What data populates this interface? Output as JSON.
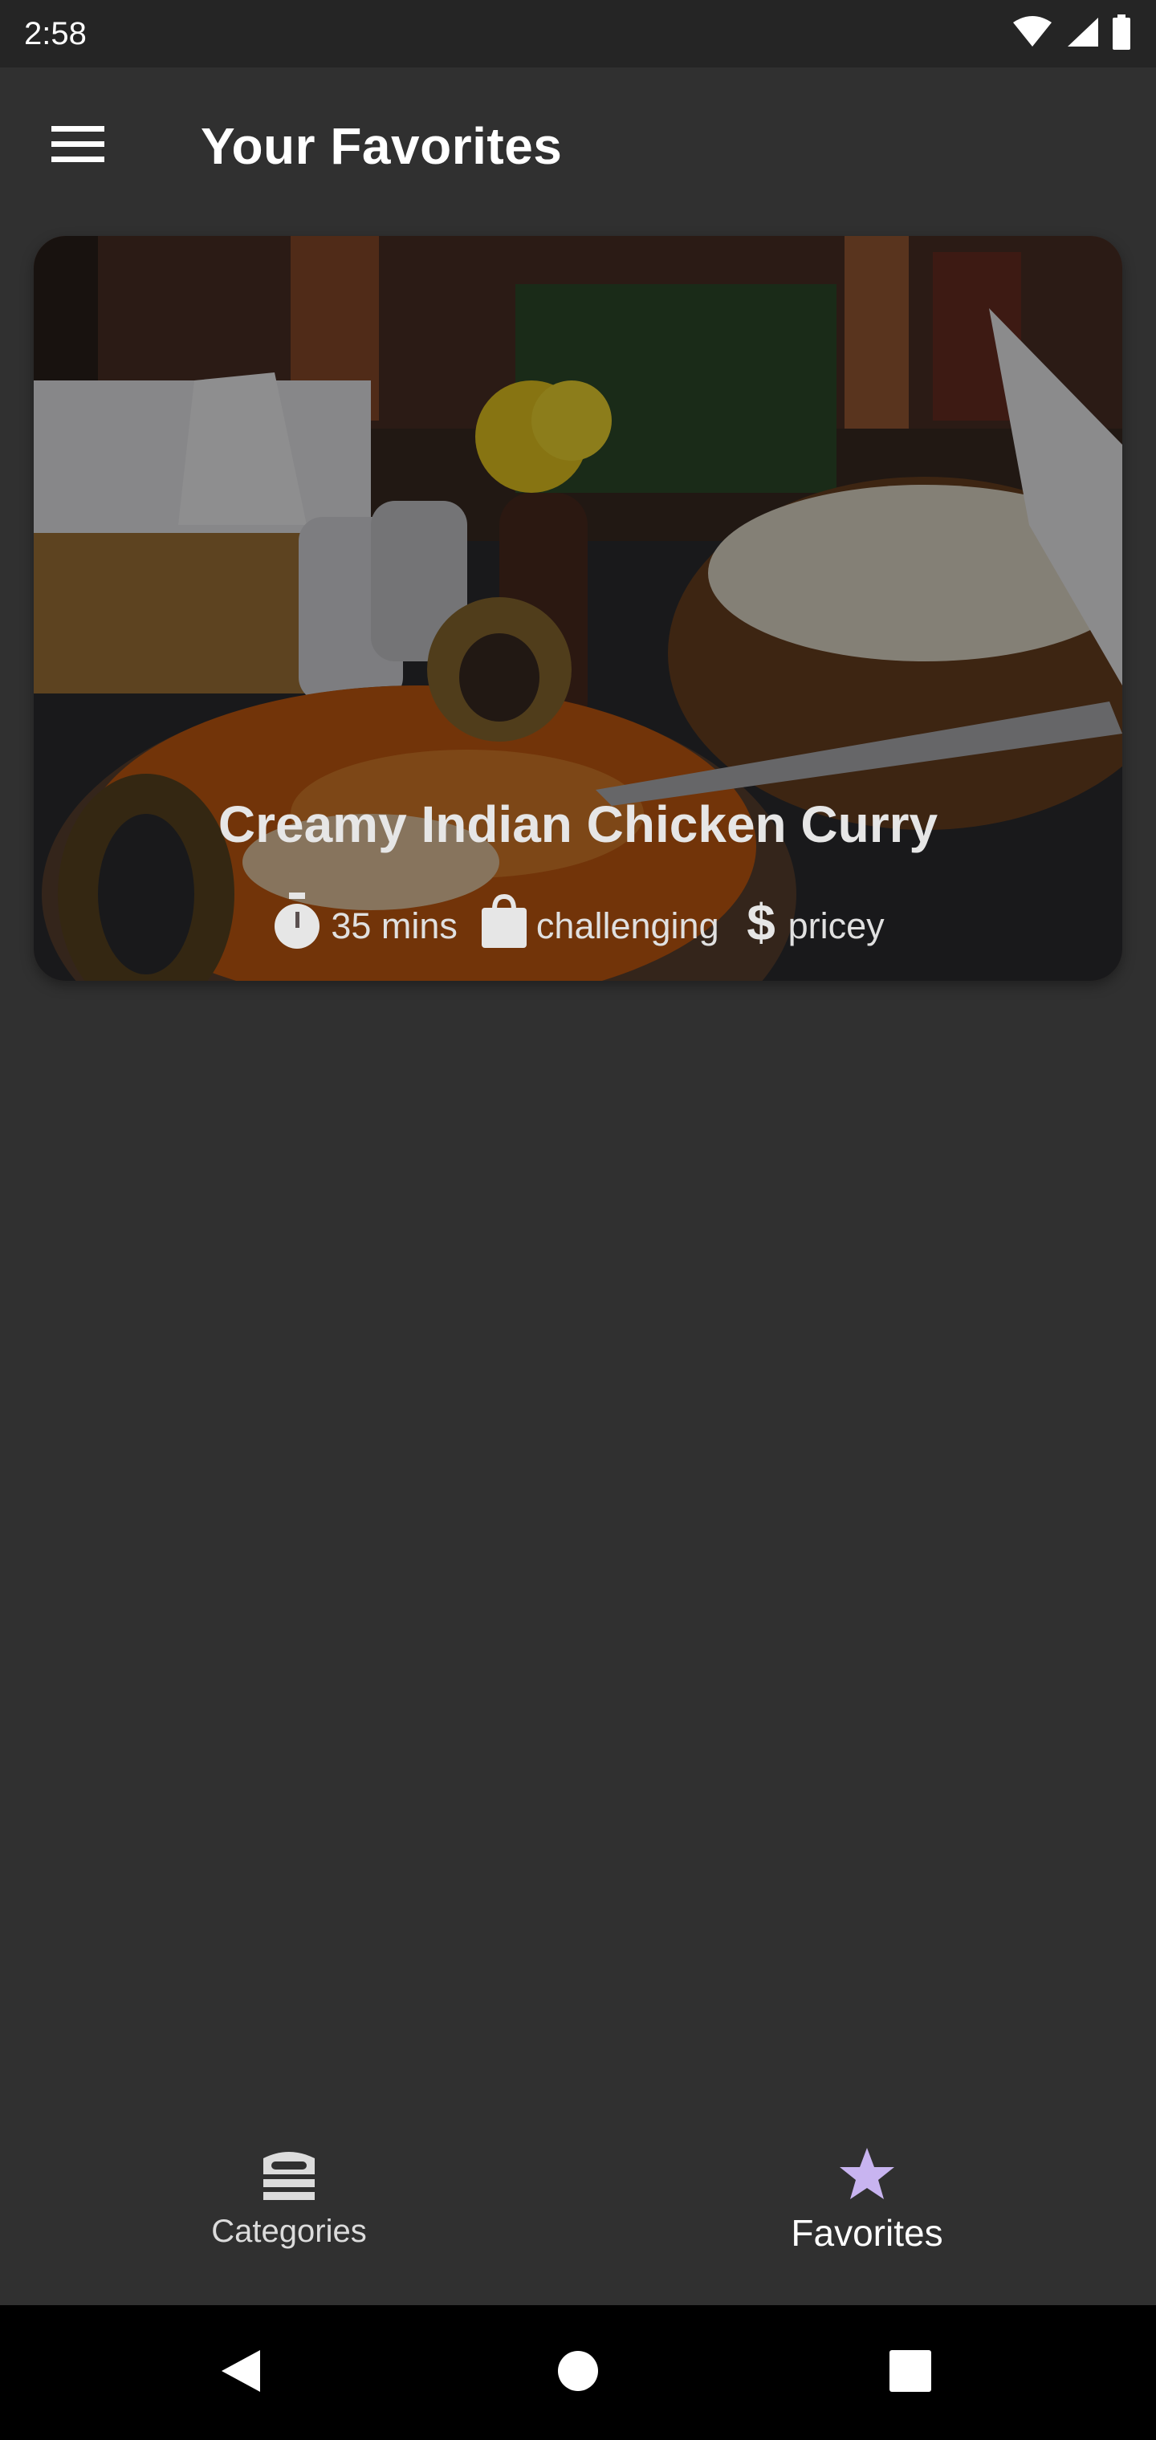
{
  "status_bar": {
    "time": "2:58",
    "icons": [
      "wifi-icon",
      "signal-icon",
      "battery-icon"
    ]
  },
  "app_bar": {
    "title": "Your Favorites",
    "menu_icon": "menu-icon"
  },
  "favorites": [
    {
      "title": "Creamy Indian Chicken Curry",
      "duration": "35 mins",
      "complexity": "challenging",
      "affordability": "pricey",
      "icons": {
        "duration": "timer-icon",
        "complexity": "shopping-bag-icon",
        "affordability": "dollar-icon"
      }
    }
  ],
  "bottom_nav": {
    "items": [
      {
        "label": "Categories",
        "icon": "category-icon",
        "active": false
      },
      {
        "label": "Favorites",
        "icon": "star-icon",
        "active": true
      }
    ],
    "active_color": "#c8b4f0"
  },
  "system_nav": {
    "buttons": [
      "back-icon",
      "home-icon",
      "recents-icon"
    ]
  }
}
